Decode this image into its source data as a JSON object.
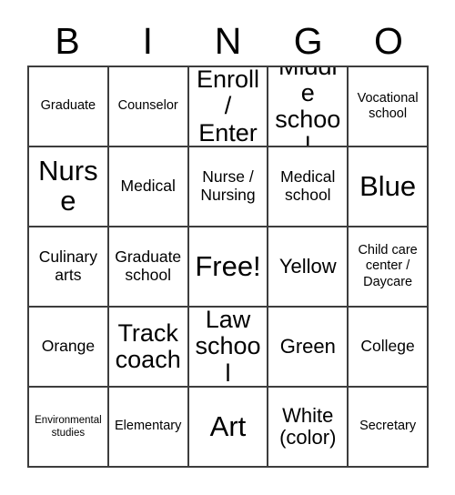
{
  "card": {
    "title": "BINGO card",
    "header_letters": [
      "B",
      "I",
      "N",
      "G",
      "O"
    ],
    "rows": [
      [
        {
          "text": "Graduate",
          "size": "sz-s"
        },
        {
          "text": "Counselor",
          "size": "sz-s"
        },
        {
          "text": "Enroll / Enter",
          "size": "sz-xl"
        },
        {
          "text": "Middle school",
          "size": "sz-xl"
        },
        {
          "text": "Vocational school",
          "size": "sz-s"
        }
      ],
      [
        {
          "text": "Nurse",
          "size": "sz-xxl"
        },
        {
          "text": "Medical",
          "size": "sz-m"
        },
        {
          "text": "Nurse / Nursing",
          "size": "sz-m"
        },
        {
          "text": "Medical school",
          "size": "sz-m"
        },
        {
          "text": "Blue",
          "size": "sz-xxl"
        }
      ],
      [
        {
          "text": "Culinary arts",
          "size": "sz-m"
        },
        {
          "text": "Graduate school",
          "size": "sz-m"
        },
        {
          "text": "Free!",
          "size": "sz-xxl"
        },
        {
          "text": "Yellow",
          "size": "sz-l"
        },
        {
          "text": "Child care center / Daycare",
          "size": "sz-s"
        }
      ],
      [
        {
          "text": "Orange",
          "size": "sz-m"
        },
        {
          "text": "Track coach",
          "size": "sz-xl"
        },
        {
          "text": "Law school",
          "size": "sz-xl"
        },
        {
          "text": "Green",
          "size": "sz-l"
        },
        {
          "text": "College",
          "size": "sz-m"
        }
      ],
      [
        {
          "text": "Environmental studies",
          "size": "sz-xs"
        },
        {
          "text": "Elementary",
          "size": "sz-s"
        },
        {
          "text": "Art",
          "size": "sz-xxl"
        },
        {
          "text": "White (color)",
          "size": "sz-l"
        },
        {
          "text": "Secretary",
          "size": "sz-s"
        }
      ]
    ]
  },
  "colors": {
    "border": "#3d3d3d",
    "background": "#ffffff",
    "text": "#000000"
  }
}
